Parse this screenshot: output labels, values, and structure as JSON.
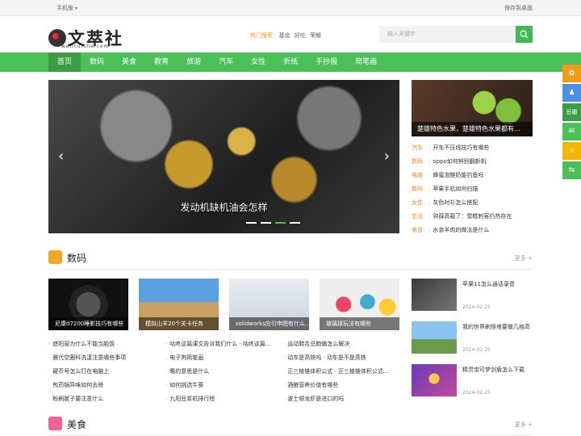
{
  "topbar": {
    "mobile": "手机版",
    "save_desktop": "保存到桌面"
  },
  "header": {
    "logo_text": "文萃社",
    "logo_domain": "wencuishe.com",
    "hot_label": "热门搜索:",
    "hot_words": [
      "基金",
      "好吃",
      "荣耀"
    ],
    "search_placeholder": "输入关键字"
  },
  "nav": {
    "items": [
      "首页",
      "数码",
      "美食",
      "教育",
      "旅游",
      "汽车",
      "女性",
      "折纸",
      "手抄报",
      "简笔画"
    ]
  },
  "slider": {
    "caption": "发动机缺机油会怎样",
    "active_dot": 2
  },
  "side": {
    "feature_caption": "楚雄特色水果，楚雄特色水果都有...",
    "list": [
      {
        "cat": "汽车",
        "title": "开车不压线技巧有哪些"
      },
      {
        "cat": "数码",
        "title": "oppo如何辨别翻新机"
      },
      {
        "cat": "电脑",
        "title": "蜂蜜泡鲍奶能钓鱼吗"
      },
      {
        "cat": "数码",
        "title": "苹果手机如何扫描"
      },
      {
        "cat": "女性",
        "title": "灰色衬衫怎么搭配"
      },
      {
        "cat": "生活",
        "title": "钟薛高载了：雪糕刺客仍热存在"
      },
      {
        "cat": "美食",
        "title": "水余羊肉的做法是什么"
      }
    ]
  },
  "section_digital": {
    "title": "数码",
    "more": "更多 +",
    "cards": [
      {
        "caption": "尼康d7200睡影技巧有哪些"
      },
      {
        "caption": "模拟山羊20个关卡任务"
      },
      {
        "caption": "solidworks应引申图有什么..."
      },
      {
        "caption": "玻璃球玩法有哪些"
      }
    ],
    "col1": [
      "遮阳窗为什么不能当胎饭",
      "晨代空圈科洗漾注意哪些事项",
      "硬币号怎么打在电脑上",
      "煎药锅异味如何去除",
      "粉刷腻子要注意什么"
    ],
    "col2": [
      "咕咚这篇课文告诉我们什么 · 咕咚这篇...",
      "电子狗简笔画",
      "瞻的意思是什么",
      "如何挑选牛蒡",
      "九阳豆浆机排行榜"
    ],
    "col3": [
      "运动鞋舌总跑偏怎么解决",
      "动车是高铁吗 · 动车是不是高铁",
      "正三棱锥体积公式 · 正三棱锥体积公式...",
      "酒酿营养价值有哪些",
      "波士顿龙虾是进口的吗"
    ],
    "right": [
      {
        "title": "苹果11怎么通话录音",
        "date": "2024-02-25"
      },
      {
        "title": "我的世界刷怪塔要做几格高",
        "date": "2024-02-25"
      },
      {
        "title": "精灵宝可梦剑盾怎么下载",
        "date": "2024-02-25"
      }
    ]
  },
  "section_food": {
    "title": "美食",
    "more": "更多 +"
  },
  "float_bar": [
    {
      "icon": "weibo-icon",
      "glyph": "✿",
      "color": "#f39b19"
    },
    {
      "icon": "qq-icon",
      "glyph": "♟",
      "color": "#4a90e2"
    },
    {
      "icon": "douban-icon",
      "glyph": "豆瓣",
      "color": "#3a9d45"
    },
    {
      "icon": "wechat-icon",
      "glyph": "✉",
      "color": "#4bbf58"
    },
    {
      "icon": "favorite-icon",
      "glyph": "☆",
      "color": "#f5b400"
    },
    {
      "icon": "share-icon",
      "glyph": "⇆",
      "color": "#4bbf58"
    }
  ]
}
